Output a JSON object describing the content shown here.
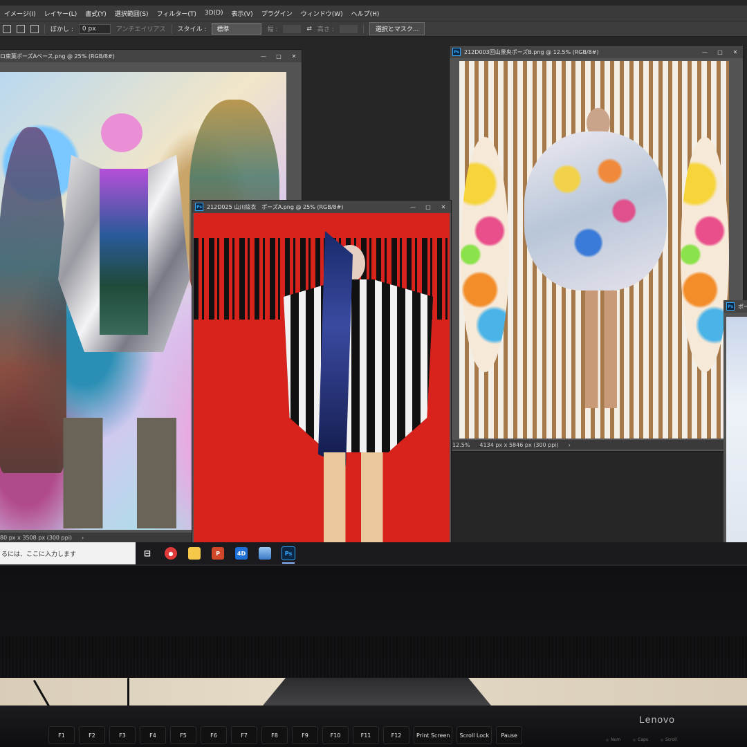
{
  "menu": {
    "items": [
      "イメージ(I)",
      "レイヤー(L)",
      "書式(Y)",
      "選択範囲(S)",
      "フィルター(T)",
      "3D(D)",
      "表示(V)",
      "プラグイン",
      "ウィンドウ(W)",
      "ヘルプ(H)"
    ]
  },
  "options_bar": {
    "feather_label": "ぼかし :",
    "feather_value": "0 px",
    "antialias_label": "アンチエイリアス",
    "style_label": "スタイル :",
    "style_value": "標準",
    "width_label": "幅 :",
    "height_label": "高さ :",
    "select_mask_label": "選択とマスク..."
  },
  "windows": {
    "left": {
      "title": "ロ束葉ポーズAベース.png @ 25% (RGB/8#)",
      "status": "80 px x 3508 px (300 ppi)"
    },
    "center": {
      "title": "212D025 山川絃衣　ポーズA.png @ 25% (RGB/8#)"
    },
    "right": {
      "title": "212D003回山景央ポーズB.png @ 12.5% (RGB/8#)",
      "zoom": "12.5%",
      "status": "4134 px x 5846 px (300 ppi)"
    },
    "far_right": {
      "title": "ポー"
    }
  },
  "taskbar": {
    "search_placeholder": "るには、ここに入力します",
    "apps": [
      {
        "name": "task-view",
        "label": ""
      },
      {
        "name": "app-red",
        "label": ""
      },
      {
        "name": "file-explorer",
        "label": ""
      },
      {
        "name": "powerpoint",
        "label": "P"
      },
      {
        "name": "app-4d",
        "label": "4D"
      },
      {
        "name": "app-window",
        "label": ""
      },
      {
        "name": "photoshop",
        "label": "Ps"
      }
    ]
  },
  "window_controls": {
    "minimize": "—",
    "maximize": "□",
    "close": "✕"
  },
  "keyboard": {
    "brand": "Lenovo",
    "keys": [
      "F1",
      "F2",
      "F3",
      "F4",
      "F5",
      "F6",
      "F7",
      "F8",
      "F9",
      "F10",
      "F11",
      "F12",
      "Print Screen",
      "Scroll Lock",
      "Pause"
    ],
    "leds": [
      "Num",
      "Caps",
      "Scroll"
    ]
  },
  "colors": {
    "ps_ui": "#3a3a3a",
    "ps_accent": "#31a8ff",
    "center_canvas_red": "#d8231c"
  }
}
